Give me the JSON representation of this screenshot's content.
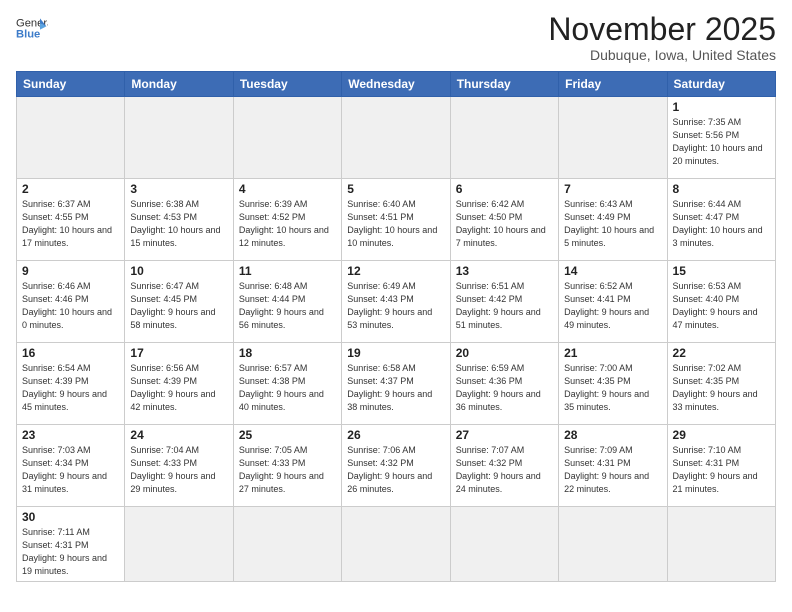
{
  "header": {
    "logo_general": "General",
    "logo_blue": "Blue",
    "month_title": "November 2025",
    "location": "Dubuque, Iowa, United States"
  },
  "weekdays": [
    "Sunday",
    "Monday",
    "Tuesday",
    "Wednesday",
    "Thursday",
    "Friday",
    "Saturday"
  ],
  "weeks": [
    [
      {
        "day": "",
        "info": "",
        "empty": true
      },
      {
        "day": "",
        "info": "",
        "empty": true
      },
      {
        "day": "",
        "info": "",
        "empty": true
      },
      {
        "day": "",
        "info": "",
        "empty": true
      },
      {
        "day": "",
        "info": "",
        "empty": true
      },
      {
        "day": "",
        "info": "",
        "empty": true
      },
      {
        "day": "1",
        "info": "Sunrise: 7:35 AM\nSunset: 5:56 PM\nDaylight: 10 hours and 20 minutes."
      }
    ],
    [
      {
        "day": "2",
        "info": "Sunrise: 6:37 AM\nSunset: 4:55 PM\nDaylight: 10 hours and 17 minutes."
      },
      {
        "day": "3",
        "info": "Sunrise: 6:38 AM\nSunset: 4:53 PM\nDaylight: 10 hours and 15 minutes."
      },
      {
        "day": "4",
        "info": "Sunrise: 6:39 AM\nSunset: 4:52 PM\nDaylight: 10 hours and 12 minutes."
      },
      {
        "day": "5",
        "info": "Sunrise: 6:40 AM\nSunset: 4:51 PM\nDaylight: 10 hours and 10 minutes."
      },
      {
        "day": "6",
        "info": "Sunrise: 6:42 AM\nSunset: 4:50 PM\nDaylight: 10 hours and 7 minutes."
      },
      {
        "day": "7",
        "info": "Sunrise: 6:43 AM\nSunset: 4:49 PM\nDaylight: 10 hours and 5 minutes."
      },
      {
        "day": "8",
        "info": "Sunrise: 6:44 AM\nSunset: 4:47 PM\nDaylight: 10 hours and 3 minutes."
      }
    ],
    [
      {
        "day": "9",
        "info": "Sunrise: 6:46 AM\nSunset: 4:46 PM\nDaylight: 10 hours and 0 minutes."
      },
      {
        "day": "10",
        "info": "Sunrise: 6:47 AM\nSunset: 4:45 PM\nDaylight: 9 hours and 58 minutes."
      },
      {
        "day": "11",
        "info": "Sunrise: 6:48 AM\nSunset: 4:44 PM\nDaylight: 9 hours and 56 minutes."
      },
      {
        "day": "12",
        "info": "Sunrise: 6:49 AM\nSunset: 4:43 PM\nDaylight: 9 hours and 53 minutes."
      },
      {
        "day": "13",
        "info": "Sunrise: 6:51 AM\nSunset: 4:42 PM\nDaylight: 9 hours and 51 minutes."
      },
      {
        "day": "14",
        "info": "Sunrise: 6:52 AM\nSunset: 4:41 PM\nDaylight: 9 hours and 49 minutes."
      },
      {
        "day": "15",
        "info": "Sunrise: 6:53 AM\nSunset: 4:40 PM\nDaylight: 9 hours and 47 minutes."
      }
    ],
    [
      {
        "day": "16",
        "info": "Sunrise: 6:54 AM\nSunset: 4:39 PM\nDaylight: 9 hours and 45 minutes."
      },
      {
        "day": "17",
        "info": "Sunrise: 6:56 AM\nSunset: 4:39 PM\nDaylight: 9 hours and 42 minutes."
      },
      {
        "day": "18",
        "info": "Sunrise: 6:57 AM\nSunset: 4:38 PM\nDaylight: 9 hours and 40 minutes."
      },
      {
        "day": "19",
        "info": "Sunrise: 6:58 AM\nSunset: 4:37 PM\nDaylight: 9 hours and 38 minutes."
      },
      {
        "day": "20",
        "info": "Sunrise: 6:59 AM\nSunset: 4:36 PM\nDaylight: 9 hours and 36 minutes."
      },
      {
        "day": "21",
        "info": "Sunrise: 7:00 AM\nSunset: 4:35 PM\nDaylight: 9 hours and 35 minutes."
      },
      {
        "day": "22",
        "info": "Sunrise: 7:02 AM\nSunset: 4:35 PM\nDaylight: 9 hours and 33 minutes."
      }
    ],
    [
      {
        "day": "23",
        "info": "Sunrise: 7:03 AM\nSunset: 4:34 PM\nDaylight: 9 hours and 31 minutes."
      },
      {
        "day": "24",
        "info": "Sunrise: 7:04 AM\nSunset: 4:33 PM\nDaylight: 9 hours and 29 minutes."
      },
      {
        "day": "25",
        "info": "Sunrise: 7:05 AM\nSunset: 4:33 PM\nDaylight: 9 hours and 27 minutes."
      },
      {
        "day": "26",
        "info": "Sunrise: 7:06 AM\nSunset: 4:32 PM\nDaylight: 9 hours and 26 minutes."
      },
      {
        "day": "27",
        "info": "Sunrise: 7:07 AM\nSunset: 4:32 PM\nDaylight: 9 hours and 24 minutes."
      },
      {
        "day": "28",
        "info": "Sunrise: 7:09 AM\nSunset: 4:31 PM\nDaylight: 9 hours and 22 minutes."
      },
      {
        "day": "29",
        "info": "Sunrise: 7:10 AM\nSunset: 4:31 PM\nDaylight: 9 hours and 21 minutes."
      }
    ],
    [
      {
        "day": "30",
        "info": "Sunrise: 7:11 AM\nSunset: 4:31 PM\nDaylight: 9 hours and 19 minutes.",
        "last": true
      },
      {
        "day": "",
        "info": "",
        "empty": true,
        "last": true
      },
      {
        "day": "",
        "info": "",
        "empty": true,
        "last": true
      },
      {
        "day": "",
        "info": "",
        "empty": true,
        "last": true
      },
      {
        "day": "",
        "info": "",
        "empty": true,
        "last": true
      },
      {
        "day": "",
        "info": "",
        "empty": true,
        "last": true
      },
      {
        "day": "",
        "info": "",
        "empty": true,
        "last": true
      }
    ]
  ]
}
